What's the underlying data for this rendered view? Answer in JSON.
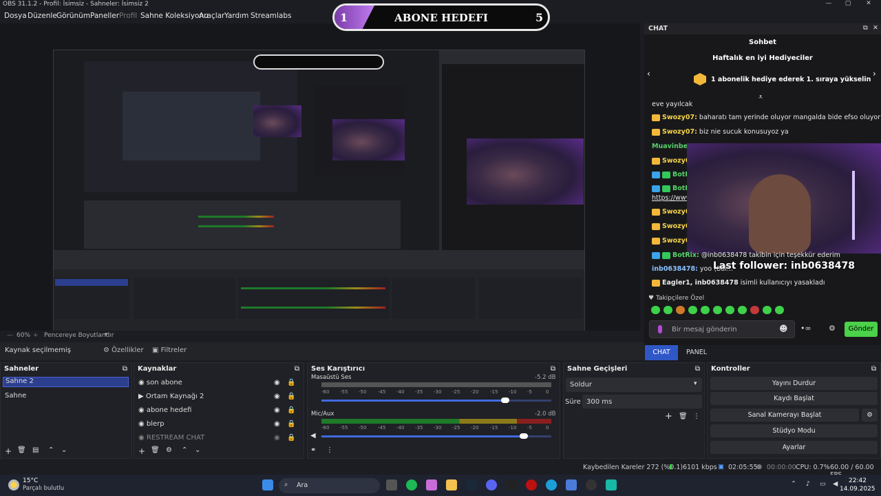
{
  "window": {
    "title": "OBS 31.1.2 - Profil: İsimsiz - Sahneler: İsimsiz 2"
  },
  "menu": {
    "items": [
      "Dosya",
      "Düzenle",
      "Görünüm",
      "Paneller",
      "Profil",
      "Sahne Koleksiyonu",
      "Araçlar",
      "Yardım",
      "Streamlabs"
    ]
  },
  "goal": {
    "start": "1",
    "label": "ABONE HEDEFI",
    "end": "5",
    "progress": 0.2
  },
  "chat": {
    "dock_title": "CHAT",
    "header": "Sohbet",
    "subheader": "Haftalık en iyi Hediyeciler",
    "gift_text": "1 abonelik hediye ederek 1. sıraya yükselin",
    "lines": [
      {
        "nick": "",
        "text": "eve yayılcak"
      },
      {
        "nick": "Swozy07:",
        "text": "baharatı tam yerinde oluyor mangalda bide efso oluyor"
      },
      {
        "nick": "Swozy07:",
        "text": "biz nie sucuk konusuyoz ya"
      },
      {
        "nick": "Muavinbey_",
        "text": ""
      },
      {
        "nick": "Swozy07",
        "text": ""
      },
      {
        "nick": "BotR",
        "text": ""
      },
      {
        "nick": "BotR",
        "text": ""
      },
      {
        "nick": "",
        "text": "https://www"
      },
      {
        "nick": "Swozy07",
        "text": ""
      },
      {
        "nick": "Swozy07",
        "text": ""
      },
      {
        "nick": "Swozy07",
        "text": ""
      },
      {
        "nick": "BotRix:",
        "text": "@inb0638478 takibin için teşekkür ederim"
      },
      {
        "nick": "inb0638478:",
        "text": "yoo (Bal..."
      },
      {
        "nick": "Eagler1, inb0638478",
        "text": "isimli kullanıcıyı yasakladı"
      }
    ],
    "followers_label": "Takipçilere Özel",
    "input_placeholder": "Bir mesaj gönderin",
    "send": "Gönder",
    "tab_chat": "CHAT",
    "tab_panel": "PANEL"
  },
  "overlay": {
    "last_follower": "Last follower: inb0638478"
  },
  "preview": {
    "zoom": "60%",
    "fit": "Pencereye Boyutlandır"
  },
  "toolbar": {
    "source_status": "Kaynak seçilmemiş",
    "properties": "Özellikler",
    "filters": "Filtreler"
  },
  "scenes": {
    "title": "Sahneler",
    "items": [
      "Sahne 2",
      "Sahne"
    ],
    "selected": 0
  },
  "sources": {
    "title": "Kaynaklar",
    "items": [
      "son abone",
      "Ortam Kaynağı 2",
      "abone hedefi",
      "blerp",
      "RESTREAM CHAT"
    ]
  },
  "mixer": {
    "title": "Ses Karıştırıcı",
    "tracks": [
      {
        "name": "Masaüstü Ses",
        "db": "-5.2 dB",
        "volume": 0.8
      },
      {
        "name": "Mic/Aux",
        "db": "-2.0 dB",
        "volume": 0.88
      }
    ],
    "scale": [
      "-60",
      "-55",
      "-50",
      "-45",
      "-40",
      "-35",
      "-30",
      "-25",
      "-20",
      "-15",
      "-10",
      "-5",
      "0"
    ]
  },
  "transitions": {
    "title": "Sahne Geçişleri",
    "type": "Soldur",
    "duration_label": "Süre",
    "duration": "300 ms"
  },
  "controls": {
    "title": "Kontroller",
    "buttons": [
      "Yayını Durdur",
      "Kaydı Başlat",
      "Sanal Kamerayı Başlat",
      "Stüdyo Modu",
      "Ayarlar"
    ]
  },
  "status": {
    "dropped": "Kaybedilen Kareler 272 (%0.1)",
    "bitrate": "6101 kbps",
    "stream_time": "02:05:55",
    "rec_time": "00:00:00",
    "cpu": "CPU: 0.7%",
    "fps": "60.00 / 60.00 FPS"
  },
  "taskbar": {
    "temp": "15°C",
    "weather": "Parçalı bulutlu",
    "search": "Ara",
    "time": "22:42",
    "date": "14.09.2025"
  },
  "colors": {
    "accent": "#2c3e8e",
    "send": "#4bd14a",
    "tab_active": "#2f57c7"
  }
}
